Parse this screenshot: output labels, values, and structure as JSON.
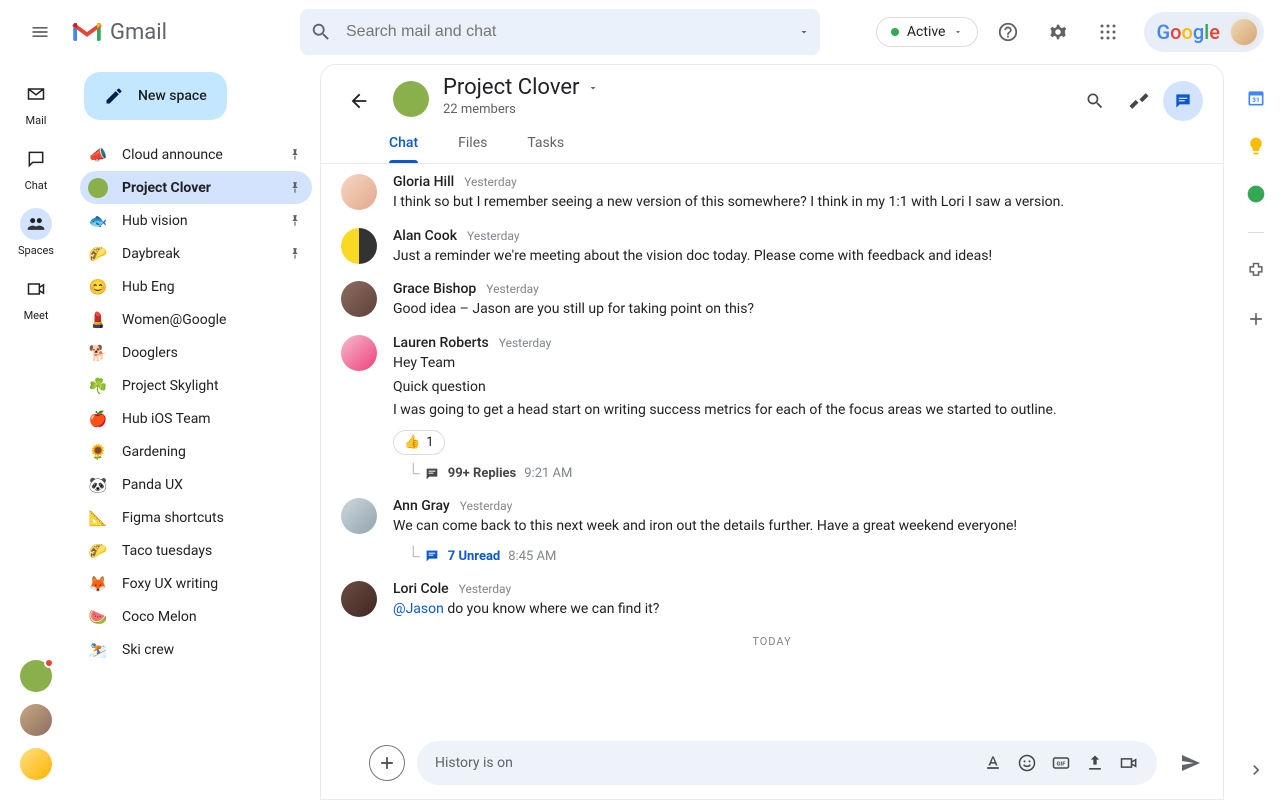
{
  "header": {
    "app_name": "Gmail",
    "search_placeholder": "Search mail and chat",
    "status_label": "Active"
  },
  "nav_rail": {
    "items": [
      {
        "label": "Mail"
      },
      {
        "label": "Chat"
      },
      {
        "label": "Spaces"
      },
      {
        "label": "Meet"
      }
    ]
  },
  "sidebar": {
    "new_space_label": "New space",
    "spaces": [
      {
        "emoji": "📣",
        "name": "Cloud announce",
        "pinned": true
      },
      {
        "emoji": "🍀",
        "name": "Project Clover",
        "pinned": true,
        "active": true,
        "avatar": true
      },
      {
        "emoji": "🐟",
        "name": "Hub vision",
        "pinned": true
      },
      {
        "emoji": "🌮",
        "name": "Daybreak",
        "pinned": true
      },
      {
        "emoji": "😊",
        "name": "Hub Eng"
      },
      {
        "emoji": "💄",
        "name": "Women@Google"
      },
      {
        "emoji": "🐕",
        "name": "Dooglers"
      },
      {
        "emoji": "☘️",
        "name": "Project Skylight"
      },
      {
        "emoji": "🍎",
        "name": "Hub iOS Team"
      },
      {
        "emoji": "🌻",
        "name": "Gardening"
      },
      {
        "emoji": "🐼",
        "name": "Panda UX"
      },
      {
        "emoji": "📐",
        "name": "Figma shortcuts"
      },
      {
        "emoji": "🌮",
        "name": "Taco tuesdays"
      },
      {
        "emoji": "🦊",
        "name": "Foxy UX writing"
      },
      {
        "emoji": "🍉",
        "name": "Coco Melon"
      },
      {
        "emoji": "⛷️",
        "name": "Ski crew"
      }
    ]
  },
  "space": {
    "title": "Project Clover",
    "members_label": "22 members",
    "tabs": [
      {
        "label": "Chat",
        "active": true
      },
      {
        "label": "Files"
      },
      {
        "label": "Tasks"
      }
    ]
  },
  "messages": [
    {
      "author": "Gloria Hill",
      "time": "Yesterday",
      "av": "av-a",
      "text": "I think so but I remember seeing a new version of this somewhere? I think in my 1:1 with Lori I saw a version."
    },
    {
      "author": "Alan Cook",
      "time": "Yesterday",
      "av": "av-b",
      "text": "Just a reminder we're meeting about the vision doc today. Please come with feedback and ideas!"
    },
    {
      "author": "Grace Bishop",
      "time": "Yesterday",
      "av": "av-c",
      "text": "Good idea – Jason are you still up for taking point on this?"
    },
    {
      "author": "Lauren Roberts",
      "time": "Yesterday",
      "av": "av-d",
      "lines": [
        "Hey Team",
        "Quick question",
        "I was going to get a head start on writing success metrics for each of the focus areas we started to outline."
      ],
      "reaction": {
        "emoji": "👍",
        "count": "1"
      },
      "thread": {
        "label": "99+ Replies",
        "time": "9:21 AM"
      }
    },
    {
      "author": "Ann Gray",
      "time": "Yesterday",
      "av": "av-e",
      "text": "We can come back to this next week and iron out the details further. Have a great weekend everyone!",
      "thread_unread": {
        "label": "7 Unread",
        "time": "8:45 AM"
      }
    },
    {
      "author": "Lori Cole",
      "time": "Yesterday",
      "av": "av-f",
      "mention": "@Jason",
      "text": " do you know where we can find it?"
    }
  ],
  "divider": "TODAY",
  "compose": {
    "placeholder": "History is on"
  }
}
